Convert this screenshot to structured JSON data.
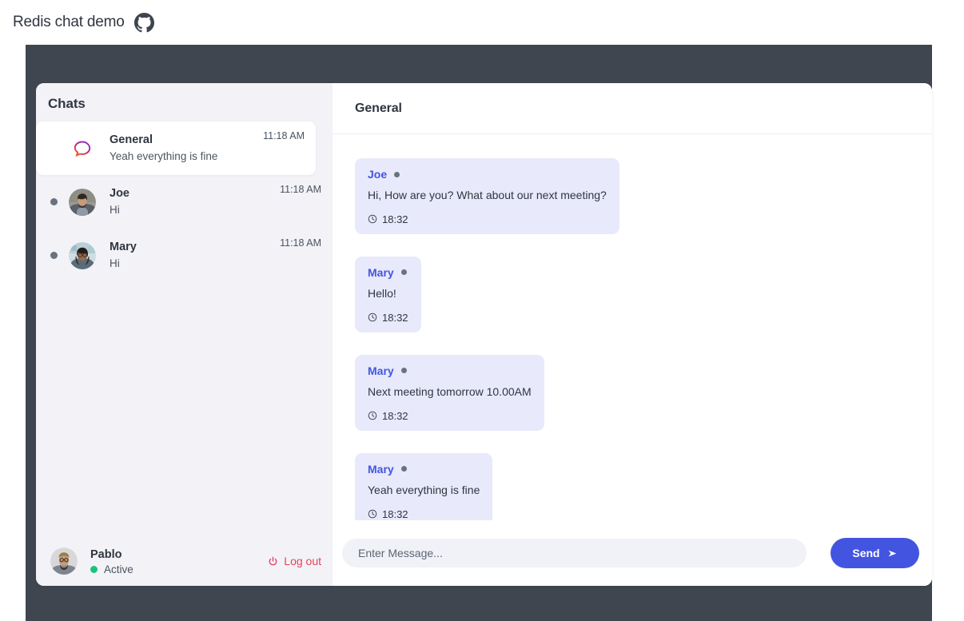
{
  "topbar": {
    "title": "Redis chat demo",
    "github_icon": "github-icon"
  },
  "sidebar": {
    "title": "Chats",
    "chats": [
      {
        "name": "General",
        "preview": "Yeah everything is fine",
        "time": "11:18 AM",
        "icon": "speech-bubble-icon",
        "active": true,
        "online": false
      },
      {
        "name": "Joe",
        "preview": "Hi",
        "time": "11:18 AM",
        "icon": "avatar",
        "active": false,
        "online": true
      },
      {
        "name": "Mary",
        "preview": "Hi",
        "time": "11:18 AM",
        "icon": "avatar",
        "active": false,
        "online": true
      }
    ],
    "footer": {
      "name": "Pablo",
      "status": "Active",
      "logout_label": "Log out",
      "logout_icon": "power-icon",
      "status_color": "#19c37d",
      "logout_color": "#e1445a"
    }
  },
  "main": {
    "title": "General",
    "messages": [
      {
        "sender": "Joe",
        "text": "Hi, How are you? What about our next meeting?",
        "time": "18:32"
      },
      {
        "sender": "Mary",
        "text": "Hello!",
        "time": "18:32"
      },
      {
        "sender": "Mary",
        "text": "Next meeting tomorrow 10.00AM",
        "time": "18:32"
      },
      {
        "sender": "Mary",
        "text": "Yeah everything is fine",
        "time": "18:32"
      }
    ],
    "composer": {
      "placeholder": "Enter Message...",
      "send_label": "Send",
      "send_icon": "send-arrow-icon"
    }
  },
  "colors": {
    "accent": "#4355e0",
    "stage": "#40464f",
    "sidebar_bg": "#f2f2f7",
    "bubble_bg": "#e8e9fa",
    "text": "#2f3640"
  }
}
